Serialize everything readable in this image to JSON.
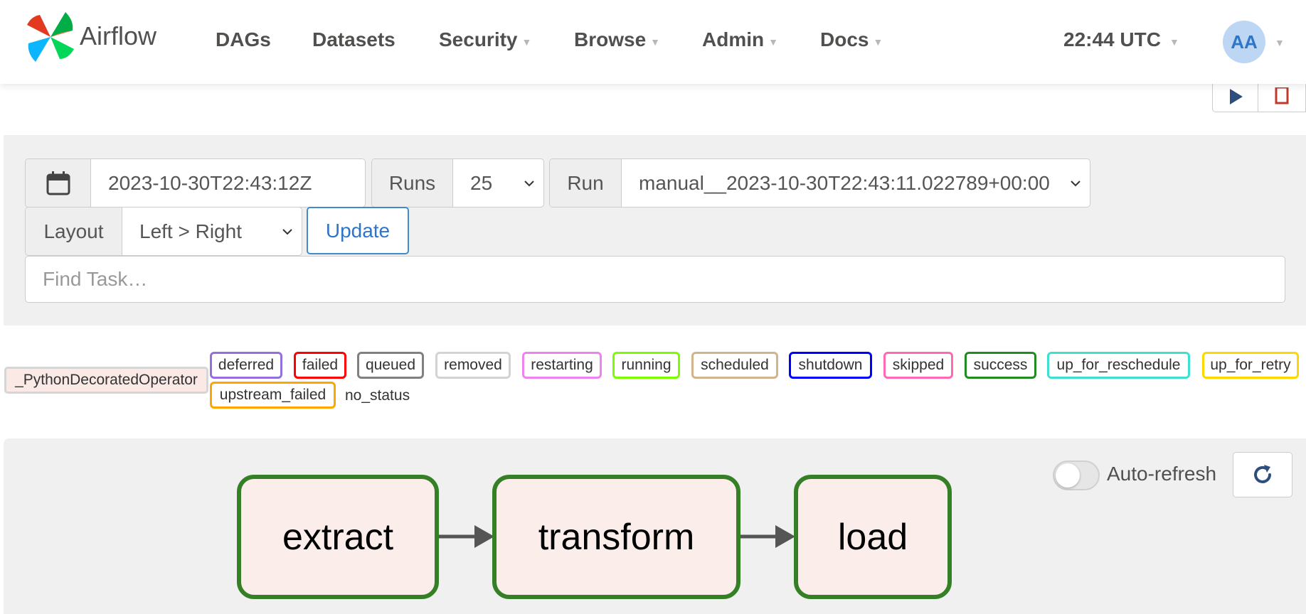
{
  "nav": {
    "brand": "Airflow",
    "items": [
      {
        "label": "DAGs",
        "has_caret": false
      },
      {
        "label": "Datasets",
        "has_caret": false
      },
      {
        "label": "Security",
        "has_caret": true
      },
      {
        "label": "Browse",
        "has_caret": true
      },
      {
        "label": "Admin",
        "has_caret": true
      },
      {
        "label": "Docs",
        "has_caret": true
      }
    ],
    "clock": "22:44 UTC",
    "avatar_initials": "AA"
  },
  "filters": {
    "date_value": "2023-10-30T22:43:12Z",
    "runs_label": "Runs",
    "runs_value": "25",
    "run_label": "Run",
    "run_value": "manual__2023-10-30T22:43:11.022789+00:00",
    "layout_label": "Layout",
    "layout_value": "Left > Right",
    "update_label": "Update",
    "find_placeholder": "Find Task…"
  },
  "legend": {
    "operator": "_PythonDecoratedOperator",
    "states": [
      {
        "label": "deferred",
        "color": "#9370db"
      },
      {
        "label": "failed",
        "color": "#ff0000"
      },
      {
        "label": "queued",
        "color": "#808080"
      },
      {
        "label": "removed",
        "color": "#d3d3d3"
      },
      {
        "label": "restarting",
        "color": "#ee82ee"
      },
      {
        "label": "running",
        "color": "#7cfc00"
      },
      {
        "label": "scheduled",
        "color": "#d2b48c"
      },
      {
        "label": "shutdown",
        "color": "#0000ff"
      },
      {
        "label": "skipped",
        "color": "#ff69b4"
      },
      {
        "label": "success",
        "color": "#228b22"
      },
      {
        "label": "up_for_reschedule",
        "color": "#40e0d0"
      },
      {
        "label": "up_for_retry",
        "color": "#ffd700"
      },
      {
        "label": "upstream_failed",
        "color": "#ffa500"
      }
    ],
    "no_status": "no_status"
  },
  "graph": {
    "auto_refresh_label": "Auto-refresh",
    "auto_refresh_on": false,
    "nodes": [
      {
        "label": "extract",
        "state": "success"
      },
      {
        "label": "transform",
        "state": "success"
      },
      {
        "label": "load",
        "state": "success"
      }
    ],
    "node_border_color": "#358027",
    "node_fill_color": "#fbeeea"
  }
}
